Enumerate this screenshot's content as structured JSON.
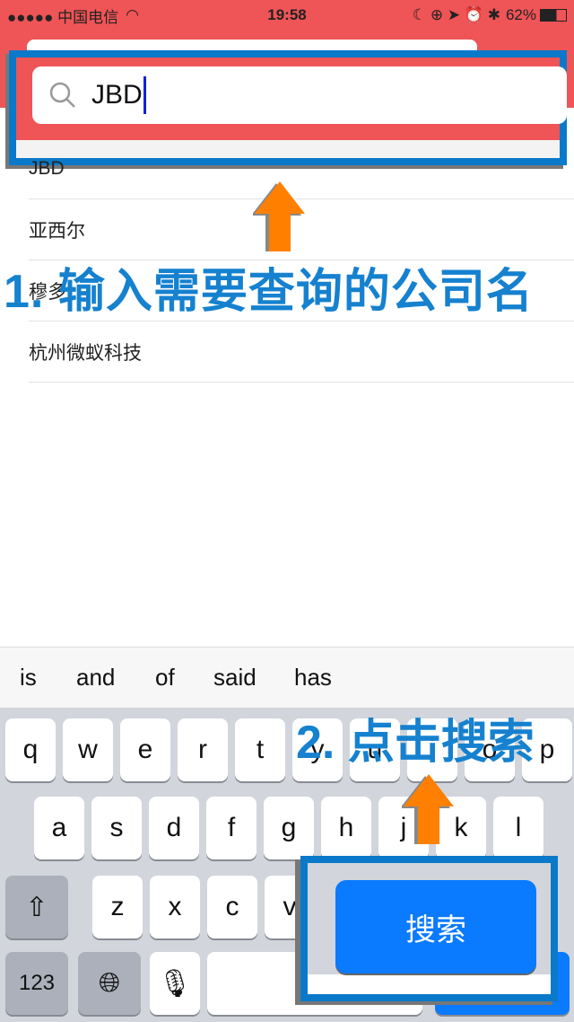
{
  "status_bar": {
    "carrier": "●●●●● 中国电信",
    "time": "19:58",
    "battery": "62%"
  },
  "search": {
    "value": "JBD"
  },
  "results": [
    "JBD",
    "亚西尔",
    "穆多",
    "杭州微蚁科技"
  ],
  "annotations": {
    "step1": "1. 输入需要查询的公司名",
    "step2": "2. 点击搜索"
  },
  "suggestions": [
    "is",
    "and",
    "of",
    "said",
    "has"
  ],
  "keyboard": {
    "row1": [
      "q",
      "w",
      "e",
      "r",
      "t",
      "y",
      "u",
      "i",
      "o",
      "p"
    ],
    "row2": [
      "a",
      "s",
      "d",
      "f",
      "g",
      "h",
      "j",
      "k",
      "l"
    ],
    "row3": [
      "z",
      "x",
      "c",
      "v"
    ],
    "numbers": "123",
    "search_label": "搜索"
  },
  "colors": {
    "header": "#ef5456",
    "highlight": "#0b79c9",
    "arrow": "#ff8000",
    "search_button": "#0a7aff"
  }
}
